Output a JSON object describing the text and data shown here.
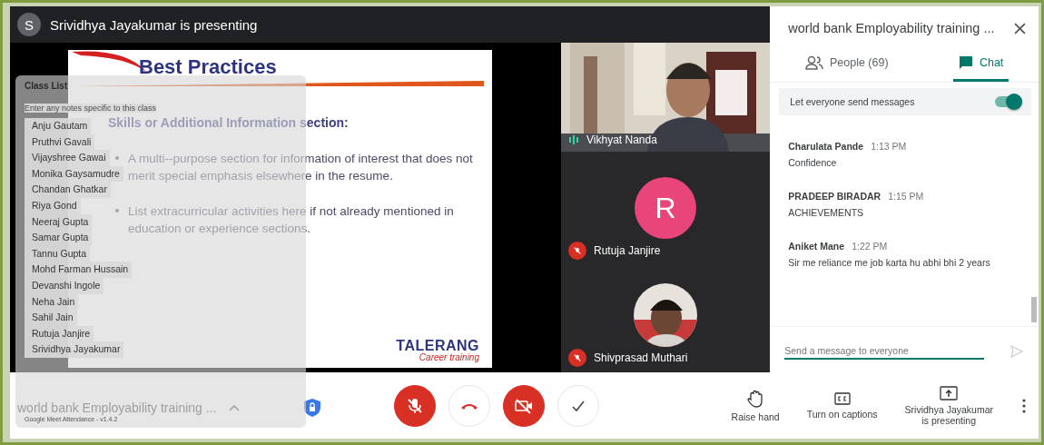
{
  "presenter_banner": {
    "avatar_letter": "S",
    "text": "Srividhya Jayakumar is presenting"
  },
  "slide": {
    "title": "Best Practices",
    "heading": "Skills or Additional Information section:",
    "bullets": [
      "A multi--purpose section for information of interest that does not merit special emphasis elsewhere in the resume.",
      "List extracurricular activities here if not already mentioned in education or experience sections."
    ],
    "logo": "TALERANG",
    "logo_tagline": "Career training"
  },
  "tiles": [
    {
      "kind": "video",
      "name": "Vikhyat Nanda",
      "muted": false
    },
    {
      "kind": "letter",
      "letter": "R",
      "color": "#e8457a",
      "name": "Rutuja Janjire",
      "muted": true
    },
    {
      "name": "Shivprasad Muthari",
      "muted": true
    }
  ],
  "attendance_overlay": {
    "title": "Class List",
    "notes_placeholder": "Enter any notes specific to this class",
    "students": [
      "Anju Gautam",
      "Pruthvi Gavali",
      "Vijayshree Gawai",
      "Monika Gaysamudre",
      "Chandan Ghatkar",
      "Riya Gond",
      "Neeraj Gupta",
      "Samar Gupta",
      "Tannu Gupta",
      "Mohd Farman Hussain",
      "Devanshi Ingole",
      "Neha Jain",
      "Sahil Jain",
      "Rutuja Janjire",
      "Srividhya Jayakumar"
    ],
    "footer": "Google Meet Attendance - v1.4.2"
  },
  "meeting_title": "world bank Employability training ...",
  "controls": [
    {
      "kind": "mic",
      "off": true
    },
    {
      "kind": "hangup",
      "off": false
    },
    {
      "kind": "camera",
      "off": true
    },
    {
      "kind": "check",
      "off": false
    }
  ],
  "actions": [
    {
      "kind": "hand",
      "label": "Raise hand"
    },
    {
      "kind": "captions",
      "label": "Turn on captions"
    },
    {
      "kind": "present",
      "label": "Srividhya Jayakumar\nis presenting"
    }
  ],
  "panel": {
    "title": "world bank Employability training ...",
    "tabs": [
      {
        "kind": "people",
        "label": "People (69)",
        "selected": false
      },
      {
        "kind": "chat",
        "label": "Chat",
        "selected": true
      }
    ],
    "toggle": {
      "label": "Let everyone send messages",
      "on": true
    },
    "messages": [
      {
        "sender": "Charulata Pande",
        "time": "1:13 PM",
        "text": "Confidence"
      },
      {
        "sender": "PRADEEP BIRADAR",
        "time": "1:15 PM",
        "text": "ACHIEVEMENTS"
      },
      {
        "sender": "Aniket Mane",
        "time": "1:22 PM",
        "text": "Sir me reliance me job karta hu abhi bhi 2 years"
      }
    ],
    "input_placeholder": "Send a message to everyone"
  }
}
